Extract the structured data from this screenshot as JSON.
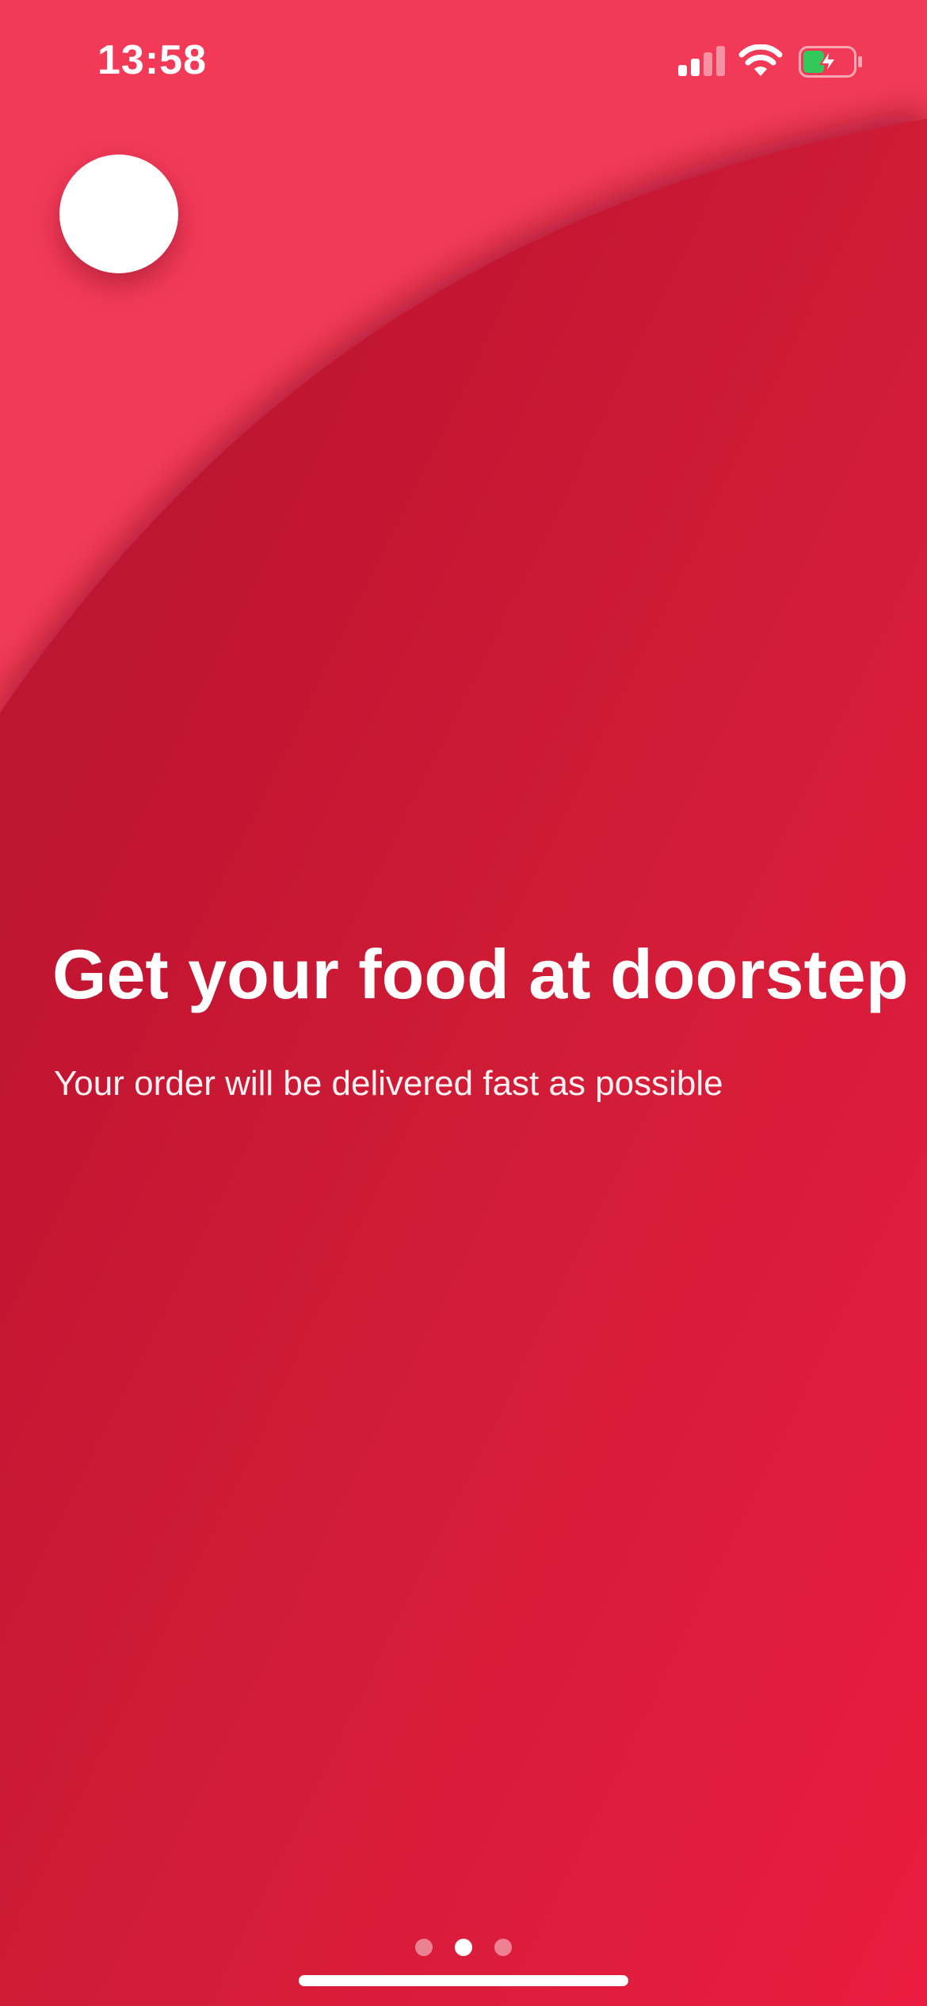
{
  "colors": {
    "top_background": "#f23a58",
    "panel_gradient_start": "#b4182e",
    "panel_gradient_end": "#e81c3e",
    "text": "#ffffff",
    "battery_fill": "#34c759"
  },
  "status_bar": {
    "time": "13:58",
    "signal_icon": "cellular-signal-icon",
    "signal_bars_active": 2,
    "signal_bars_total": 4,
    "wifi_icon": "wifi-icon",
    "battery_icon": "battery-charging-icon",
    "battery_level": 0.4,
    "charging": true
  },
  "header": {
    "avatar_icon": "profile-avatar"
  },
  "onboarding": {
    "title": "Get your food at doorstep",
    "subtitle": "Your order will be delivered fast as possible"
  },
  "pagination": {
    "total_pages": 3,
    "current_page": 2
  }
}
